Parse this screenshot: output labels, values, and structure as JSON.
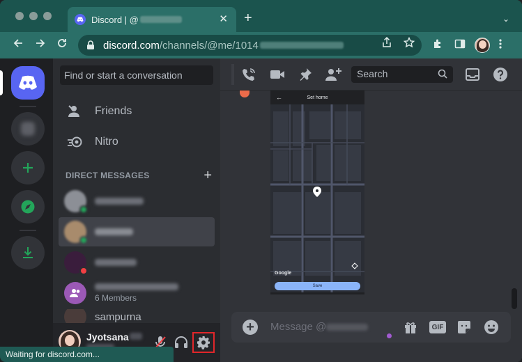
{
  "browser": {
    "tab_title": "Discord | @",
    "tab_close": "✕",
    "new_tab": "+",
    "tab_menu": "⌄",
    "url_host": "discord.com",
    "url_path": "/channels/@me/1014",
    "status_text": "Waiting for discord.com..."
  },
  "dm_sidebar": {
    "search_placeholder": "Find or start a conversation",
    "friends_label": "Friends",
    "nitro_label": "Nitro",
    "dm_header": "DIRECT MESSAGES",
    "dm_add": "+",
    "group_members": "6 Members",
    "partial_name": "sampurna"
  },
  "user": {
    "name": "Jyotsana"
  },
  "header": {
    "search_placeholder": "Search"
  },
  "map": {
    "title": "Set home",
    "google_label": "Google",
    "save_label": "Save"
  },
  "composer": {
    "placeholder": "Message @",
    "add": "+",
    "gif_label": "GIF"
  },
  "colors": {
    "blurple": "#5865f2",
    "green": "#23a55a",
    "red": "#f23f43",
    "settings_highlight": "#e1262a",
    "browser_frame": "#1b544e"
  }
}
